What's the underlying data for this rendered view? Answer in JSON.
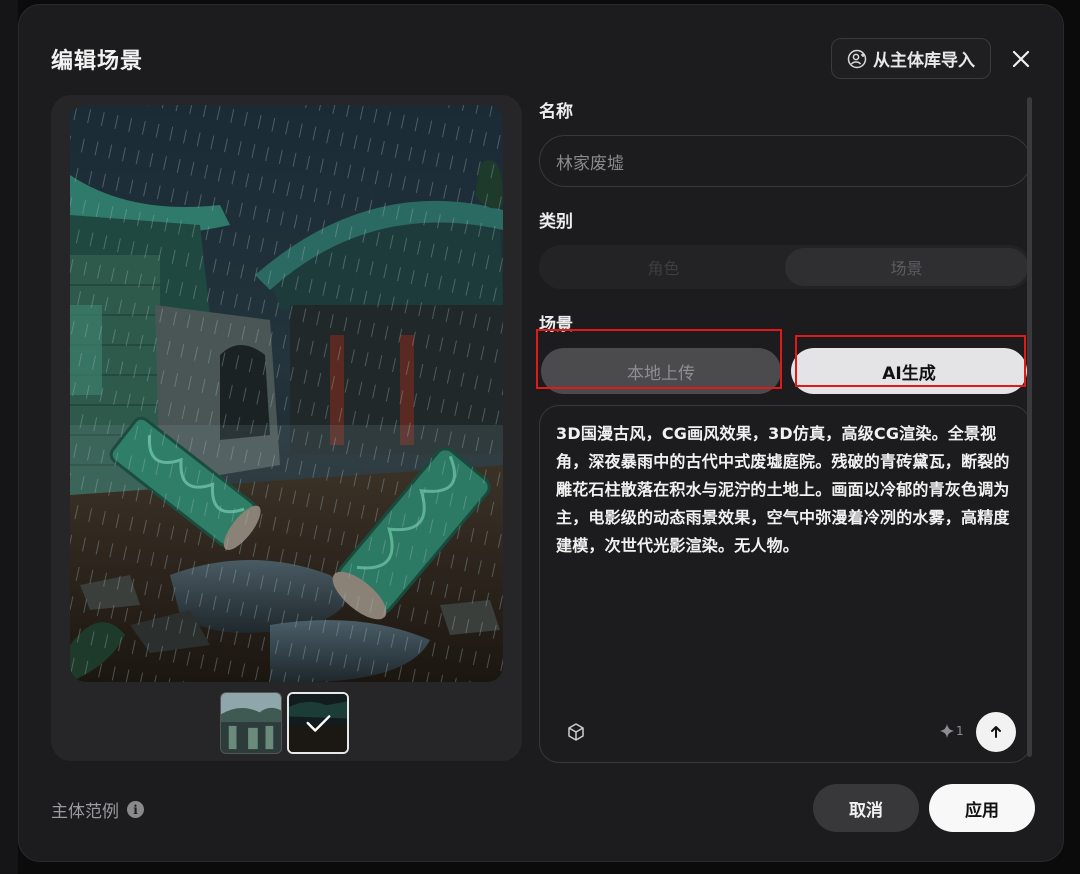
{
  "dialog": {
    "title": "编辑场景",
    "import_label": "从主体库导入"
  },
  "form": {
    "name_label": "名称",
    "name_value": "林家废墟",
    "category_label": "类别",
    "category_options": [
      "角色",
      "场景"
    ],
    "category_selected": "场景",
    "scene_label": "场景",
    "scene_options": [
      "本地上传",
      "AI生成"
    ],
    "scene_selected": "AI生成",
    "prompt": "3D国漫古风，CG画风效果，3D仿真，高级CG渲染。全景视角，深夜暴雨中的古代中式废墟庭院。残破的青砖黛瓦，断裂的雕花石柱散落在积水与泥泞的土地上。画面以冷郁的青灰色调为主，电影级的动态雨景效果，空气中弥漫着冷冽的水雾，高精度建模，次世代光影渲染。无人物。",
    "credit_count": "1"
  },
  "footer": {
    "example_label": "主体范例",
    "cancel_label": "取消",
    "apply_label": "应用"
  },
  "icons": {
    "import": "user-plus-icon",
    "close": "close-icon",
    "cube": "cube-icon",
    "credit": "sparkle-icon",
    "send": "arrow-up-icon",
    "info": "info-icon",
    "selected": "check-icon"
  },
  "colors": {
    "panel": "#1c1c1e",
    "accent_light": "#e4e4e6",
    "highlight": "#e0191b"
  }
}
